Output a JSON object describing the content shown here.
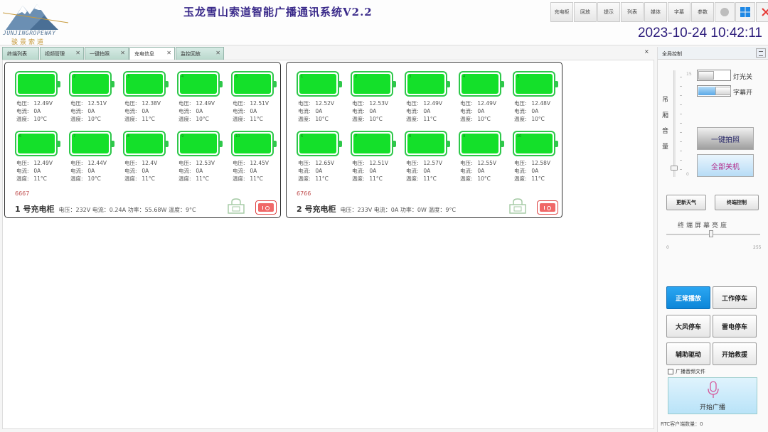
{
  "header": {
    "brand_en": "JUNJINGROPEWAY",
    "brand_cn": "骏景索道",
    "title": "玉龙雪山索道智能广播通讯系统V2.2",
    "clock": "2023-10-24 10:42:11",
    "toolbar": [
      "充电柜",
      "回放",
      "提示",
      "列表",
      "媒体",
      "字幕",
      "参数"
    ]
  },
  "tabs": [
    {
      "label": "终端列表",
      "closable": false,
      "active": false
    },
    {
      "label": "视频管理",
      "closable": true,
      "active": false
    },
    {
      "label": "一键拍照",
      "closable": true,
      "active": false
    },
    {
      "label": "充电信息",
      "closable": true,
      "active": true
    },
    {
      "label": "监控回放",
      "closable": true,
      "active": false
    }
  ],
  "tabs_close": "×",
  "cabinets": [
    {
      "code": "6667",
      "name": "1 号充电柜",
      "summary": "电压：232V  电流：0.24A  功率：55.68W  温度：9°C",
      "cells": [
        {
          "idx": "",
          "voltage": "12.49V",
          "current": "0A",
          "temp": "10°C"
        },
        {
          "idx": "2",
          "voltage": "12.51V",
          "current": "0A",
          "temp": "10°C"
        },
        {
          "idx": "3",
          "voltage": "12.38V",
          "current": "0A",
          "temp": "11°C"
        },
        {
          "idx": "4",
          "voltage": "12.49V",
          "current": "0A",
          "temp": "10°C"
        },
        {
          "idx": "5",
          "voltage": "12.51V",
          "current": "0A",
          "temp": "11°C"
        },
        {
          "idx": "6",
          "voltage": "12.49V",
          "current": "0A",
          "temp": "11°C"
        },
        {
          "idx": "7",
          "voltage": "12.44V",
          "current": "0A",
          "temp": "10°C"
        },
        {
          "idx": "8",
          "voltage": "12.4V",
          "current": "0A",
          "temp": "11°C"
        },
        {
          "idx": "9",
          "voltage": "12.53V",
          "current": "0A",
          "temp": "11°C"
        },
        {
          "idx": "10",
          "voltage": "12.45V",
          "current": "0A",
          "temp": "11°C"
        }
      ]
    },
    {
      "code": "6766",
      "name": "2 号充电柜",
      "summary": "电压：233V  电流：0A  功率：0W  温度：9°C",
      "cells": [
        {
          "idx": "1",
          "voltage": "12.52V",
          "current": "0A",
          "temp": "10°C"
        },
        {
          "idx": "2",
          "voltage": "12.53V",
          "current": "0A",
          "temp": "10°C"
        },
        {
          "idx": "3",
          "voltage": "12.49V",
          "current": "0A",
          "temp": "11°C"
        },
        {
          "idx": "4",
          "voltage": "12.49V",
          "current": "0A",
          "temp": "10°C"
        },
        {
          "idx": "5",
          "voltage": "12.48V",
          "current": "0A",
          "temp": "10°C"
        },
        {
          "idx": "6",
          "voltage": "12.65V",
          "current": "0A",
          "temp": "11°C"
        },
        {
          "idx": "7",
          "voltage": "12.51V",
          "current": "0A",
          "temp": "11°C"
        },
        {
          "idx": "8",
          "voltage": "12.57V",
          "current": "0A",
          "temp": "11°C"
        },
        {
          "idx": "9",
          "voltage": "12.55V",
          "current": "0A",
          "temp": "10°C"
        },
        {
          "idx": "10",
          "voltage": "12.58V",
          "current": "0A",
          "temp": "11°C"
        }
      ]
    }
  ],
  "cell_labels": {
    "voltage": "电压:",
    "current": "电流:",
    "temp": "温度:"
  },
  "right_panel": {
    "title": "全局控制",
    "volume_label": [
      "吊",
      "厢",
      "音",
      "量"
    ],
    "volume_max": "15",
    "volume_min": "0",
    "volume_level": 0.08,
    "light_toggle": "灯光关",
    "subtitle_toggle": "字幕开",
    "snapshot_button": "一键拍照",
    "shutdown_button": "全部关机",
    "update_weather": "更新天气",
    "terminal_control": "终端控制",
    "brightness_label": "终端屏幕亮度",
    "brightness_min": "0",
    "brightness_max": "255",
    "brightness_level": 0.48,
    "modes": [
      "正常播放",
      "工作停车",
      "大风停车",
      "雷电停车",
      "辅助驱动",
      "开始救援"
    ],
    "broadcast_checkbox": "广播音频文件",
    "broadcast_button": "开始广播",
    "rtc_status": "RTC客户端数量：0"
  },
  "colors": {
    "accent": "#0d86d8",
    "battery_green": "#14e02a",
    "title": "#3a2a8a",
    "power_red": "#f06868"
  }
}
